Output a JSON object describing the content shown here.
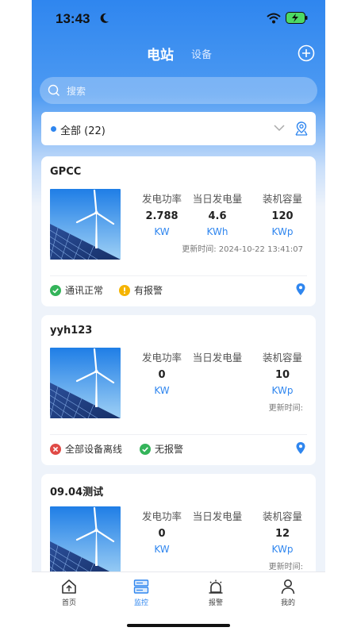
{
  "status_bar": {
    "time": "13:43"
  },
  "header": {
    "tabs": [
      "电站",
      "设备"
    ]
  },
  "search": {
    "placeholder": "搜索"
  },
  "filter": {
    "label": "全部 (22)"
  },
  "metric_labels": {
    "power": "发电功率",
    "daily": "当日发电量",
    "capacity": "装机容量"
  },
  "stations": [
    {
      "name": "GPCC",
      "power": "2.788",
      "power_unit": "KW",
      "daily": "4.6",
      "daily_unit": "KWh",
      "capacity": "120",
      "capacity_unit": "KWp",
      "update_time": "更新时间: 2024-10-22 13:41:07",
      "comm_status": "通讯正常",
      "alarm_status": "有报警"
    },
    {
      "name": "yyh123",
      "power": "0",
      "power_unit": "KW",
      "daily": "",
      "daily_unit": "",
      "capacity": "10",
      "capacity_unit": "KWp",
      "update_time": "更新时间:",
      "comm_status": "全部设备离线",
      "alarm_status": "无报警"
    },
    {
      "name": "09.04测试",
      "power": "0",
      "power_unit": "KW",
      "daily": "",
      "daily_unit": "",
      "capacity": "12",
      "capacity_unit": "KWp",
      "update_time": "更新时间:"
    }
  ],
  "tab_bar": {
    "items": [
      "首页",
      "监控",
      "报警",
      "我的"
    ],
    "active_index": 1
  },
  "colors": {
    "accent": "#2f86ef",
    "ok": "#34b45a",
    "warn": "#f5b400",
    "error": "#e04a46"
  }
}
